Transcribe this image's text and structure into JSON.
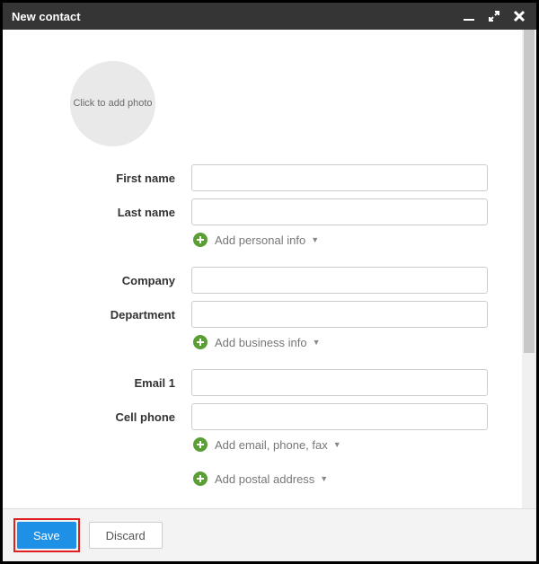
{
  "window": {
    "title": "New contact"
  },
  "photo": {
    "placeholder": "Click to add photo"
  },
  "labels": {
    "first_name": "First name",
    "last_name": "Last name",
    "company": "Company",
    "department": "Department",
    "email1": "Email 1",
    "cell_phone": "Cell phone"
  },
  "values": {
    "first_name": "",
    "last_name": "",
    "company": "",
    "department": "",
    "email1": "",
    "cell_phone": ""
  },
  "add_links": {
    "personal": "Add personal info",
    "business": "Add business info",
    "contact": "Add email, phone, fax",
    "postal": "Add postal address"
  },
  "buttons": {
    "save": "Save",
    "discard": "Discard"
  }
}
